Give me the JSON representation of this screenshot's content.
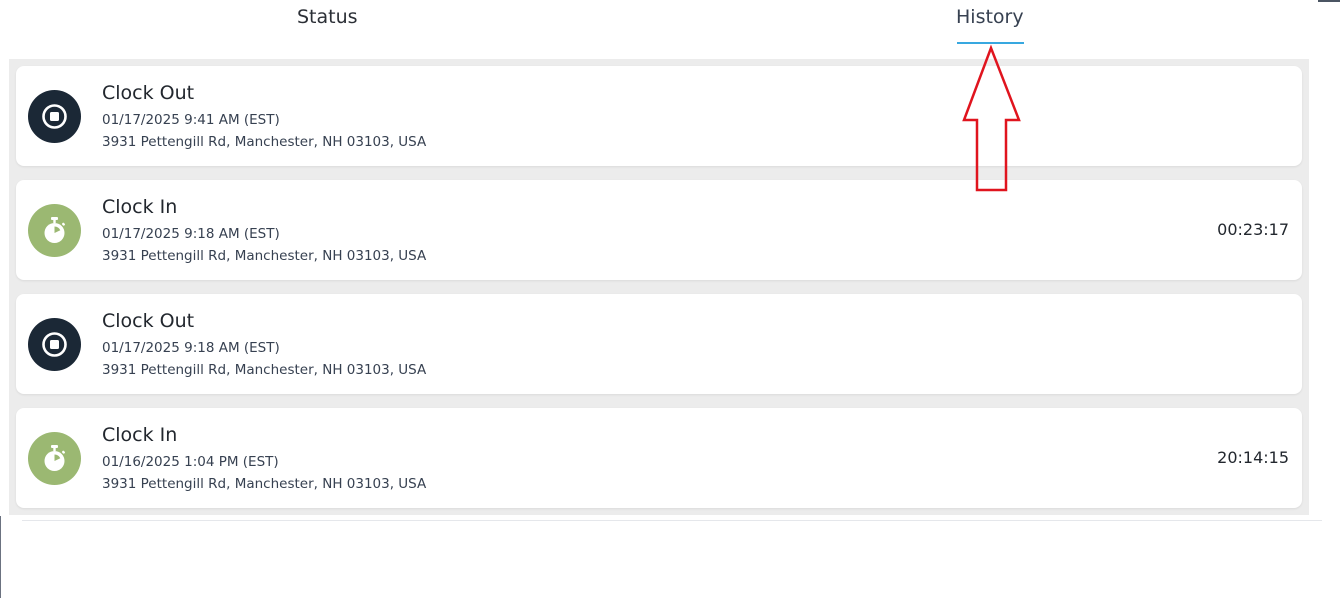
{
  "tabs": {
    "status": "Status",
    "history": "History",
    "active": "history"
  },
  "colors": {
    "clock_out_icon": "#1b2836",
    "clock_in_icon": "#9bb872",
    "active_tab_underline": "#38a8e0",
    "annotation_arrow": "#e0141e"
  },
  "entries": [
    {
      "type": "clock-out",
      "icon": "stop-icon",
      "title": "Clock Out",
      "time": "01/17/2025 9:41 AM (EST)",
      "address": "3931 Pettengill Rd, Manchester, NH 03103, USA",
      "duration": ""
    },
    {
      "type": "clock-in",
      "icon": "stopwatch-icon",
      "title": "Clock In",
      "time": "01/17/2025 9:18 AM (EST)",
      "address": "3931 Pettengill Rd, Manchester, NH 03103, USA",
      "duration": "00:23:17"
    },
    {
      "type": "clock-out",
      "icon": "stop-icon",
      "title": "Clock Out",
      "time": "01/17/2025 9:18 AM (EST)",
      "address": "3931 Pettengill Rd, Manchester, NH 03103, USA",
      "duration": ""
    },
    {
      "type": "clock-in",
      "icon": "stopwatch-icon",
      "title": "Clock In",
      "time": "01/16/2025 1:04 PM (EST)",
      "address": "3931 Pettengill Rd, Manchester, NH 03103, USA",
      "duration": "20:14:15"
    }
  ]
}
